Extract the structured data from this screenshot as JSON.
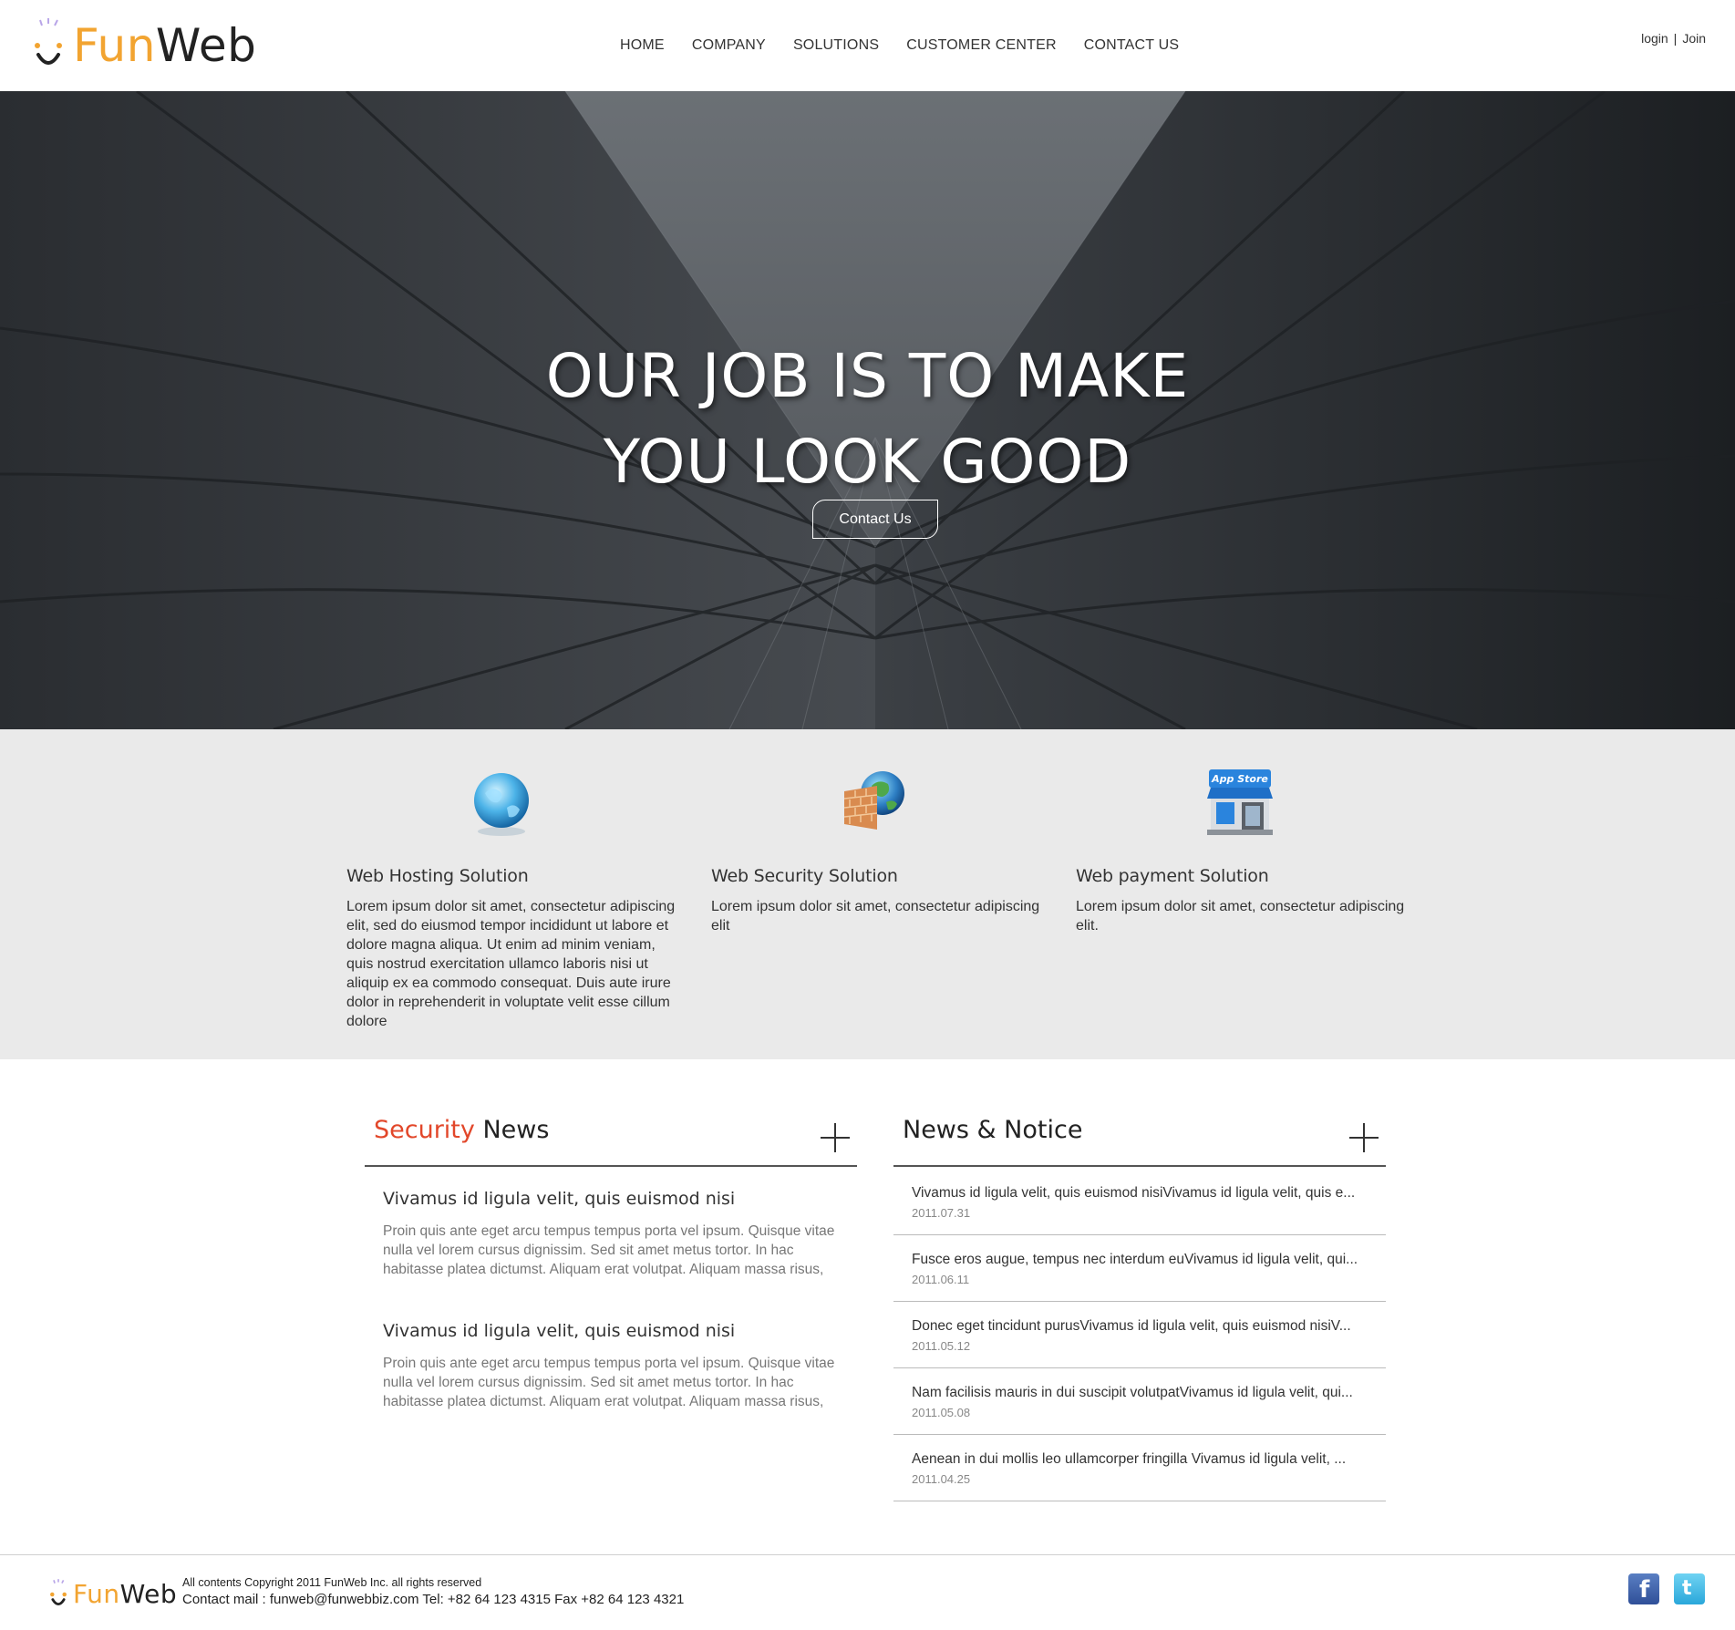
{
  "brand": {
    "fun": "Fun",
    "web": "Web"
  },
  "nav": [
    "HOME",
    "COMPANY",
    "SOLUTIONS",
    "CUSTOMER CENTER",
    "CONTACT US"
  ],
  "auth": {
    "login": "login",
    "separator": "|",
    "join": "Join"
  },
  "hero": {
    "line1": "OUR JOB IS TO MAKE",
    "line2": "YOU LOOK GOOD",
    "button": "Contact Us"
  },
  "solutions": [
    {
      "title": "Web Hosting Solution",
      "icon": "globe-icon",
      "text": "Lorem ipsum dolor sit amet, consectetur adipiscing elit, sed do eiusmod tempor incididunt ut labore et dolore magna aliqua. Ut enim ad minim veniam, quis nostrud exercitation ullamco laboris nisi ut aliquip ex ea commodo consequat. Duis aute irure dolor in reprehenderit in voluptate velit esse cillum dolore"
    },
    {
      "title": "Web Security Solution",
      "icon": "firewall-icon",
      "text": "Lorem ipsum dolor sit amet, consectetur adipiscing elit"
    },
    {
      "title": "Web payment Solution",
      "icon": "app-store-icon",
      "text": "Lorem ipsum dolor sit amet, consectetur adipiscing elit."
    }
  ],
  "app_store_label": "App Store",
  "security_news": {
    "title_accent": "Security",
    "title_rest": " News",
    "articles": [
      {
        "title": "Vivamus id ligula velit, quis euismod nisi",
        "body": "Proin quis ante eget arcu tempus tempus porta vel ipsum. Quisque vitae nulla vel lorem cursus dignissim. Sed sit amet metus tortor. In hac habitasse platea dictumst. Aliquam erat volutpat. Aliquam massa risus,"
      },
      {
        "title": "Vivamus id ligula velit, quis euismod nisi",
        "body": "Proin quis ante eget arcu tempus tempus porta vel ipsum. Quisque vitae nulla vel lorem cursus dignissim. Sed sit amet metus tortor. In hac habitasse platea dictumst. Aliquam erat volutpat. Aliquam massa risus,"
      }
    ]
  },
  "news_notice": {
    "title": "News & Notice",
    "items": [
      {
        "title": "Vivamus id ligula velit, quis euismod nisiVivamus id ligula velit, quis e...",
        "date": "2011.07.31"
      },
      {
        "title": "Fusce eros augue, tempus nec interdum euVivamus id ligula velit, qui...",
        "date": "2011.06.11"
      },
      {
        "title": "Donec eget tincidunt purusVivamus id ligula velit, quis euismod nisiV...",
        "date": "2011.05.12"
      },
      {
        "title": "Nam facilisis mauris in dui suscipit volutpatVivamus id ligula velit, qui...",
        "date": "2011.05.08"
      },
      {
        "title": "Aenean in dui mollis leo ullamcorper fringilla Vivamus id ligula velit, ...",
        "date": "2011.04.25"
      }
    ]
  },
  "footer": {
    "copyright": "All contents Copyright 2011 FunWeb Inc. all rights reserved",
    "contact": "Contact mail : funweb@funwebbiz.com Tel: +82 64 123 4315 Fax +82 64 123 4321",
    "social": [
      "facebook-icon",
      "twitter-icon"
    ]
  },
  "colors": {
    "brand_orange": "#f2a431",
    "accent_red": "#e2472a",
    "band_gray": "#eaeaea"
  }
}
